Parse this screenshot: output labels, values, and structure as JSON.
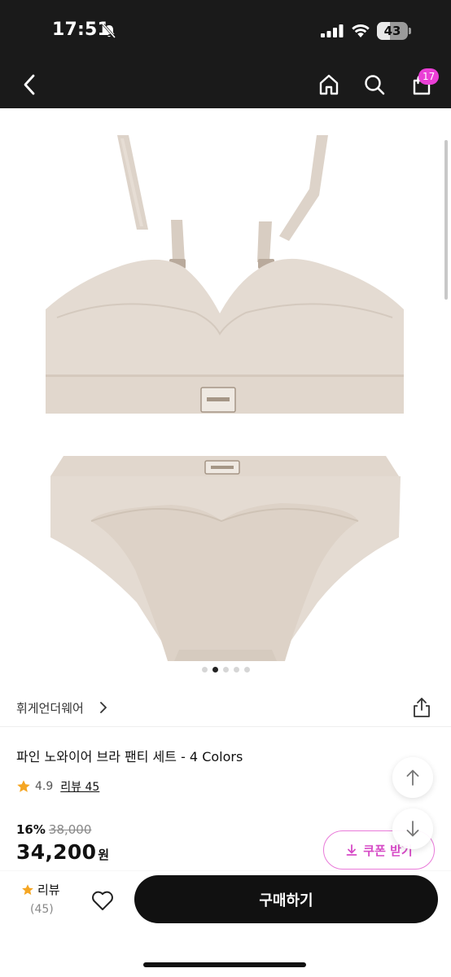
{
  "status_bar": {
    "time": "17:51",
    "battery_percent": "43",
    "battery_level": 0.43
  },
  "nav": {
    "cart_count": "17",
    "badge_color": "#ea3fd6"
  },
  "gallery": {
    "image_count": 5,
    "active_index": 1,
    "image_subject": "bra-and-panty-set-product-photo",
    "product_color": "#e4dbd2"
  },
  "brand": {
    "name": "휘게언더웨어"
  },
  "product": {
    "title": "파인 노와이어 브라 팬티 세트 - 4 Colors",
    "rating": "4.9",
    "review_label": "리뷰 45",
    "discount_rate": "16%",
    "original_price": "38,000",
    "sale_price": "34,200",
    "price_unit": "원"
  },
  "coupon": {
    "label": "쿠폰 받기",
    "accent_color": "#d64ac6"
  },
  "bottom_bar": {
    "review_label": "리뷰",
    "review_count": "(45)",
    "buy_label": "구매하기"
  },
  "icons": {
    "back": "chevron-left-icon",
    "home": "home-icon",
    "search": "search-icon",
    "cart": "shopping-bag-icon",
    "share": "share-icon",
    "star": "star-icon",
    "heart": "heart-icon",
    "scroll_top": "arrow-up-icon",
    "scroll_bottom": "arrow-down-icon",
    "download": "download-icon"
  }
}
